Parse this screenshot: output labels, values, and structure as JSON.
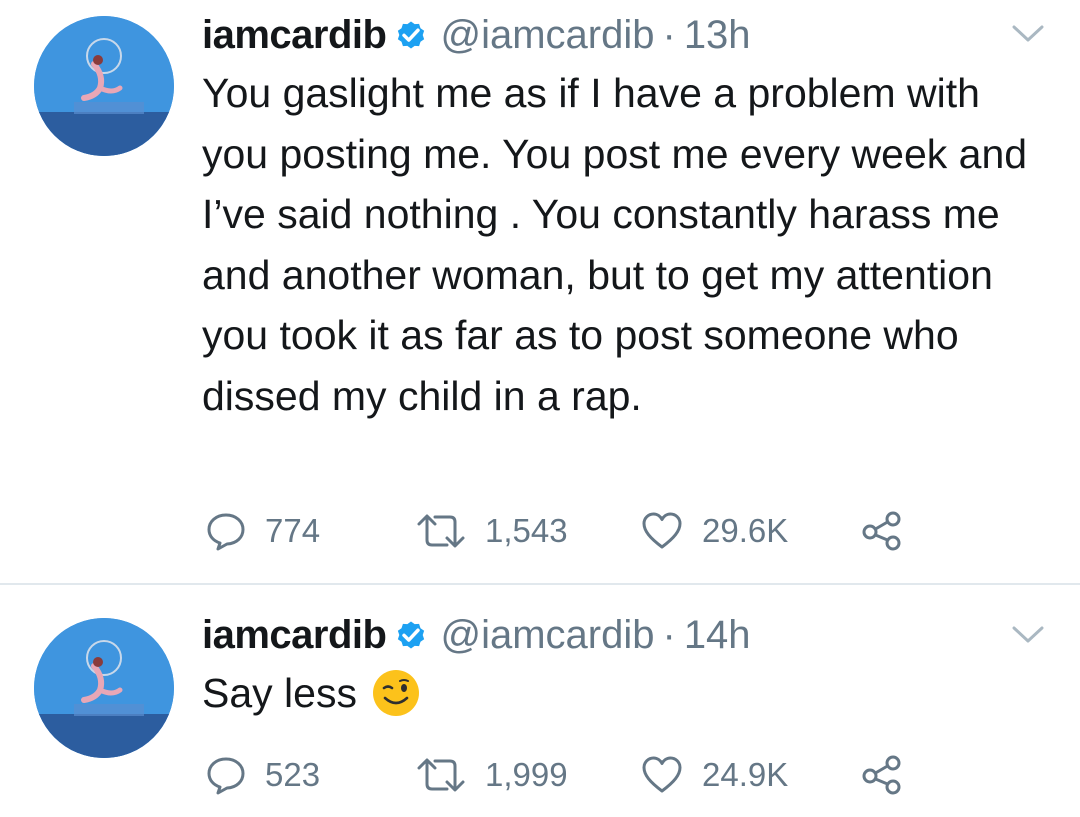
{
  "tweets": [
    {
      "display_name": "iamcardib",
      "handle": "@iamcardib",
      "separator": "·",
      "time": "13h",
      "text": "You gaslight me as if I have a problem with you posting me. You post me every week and I’ve said nothing . You constantly harass me and another woman, but to get my attention you took it as far as to post someone who dissed my child in a rap.",
      "emoji": "",
      "replies": "774",
      "retweets": "1,543",
      "likes": "29.6K"
    },
    {
      "display_name": "iamcardib",
      "handle": "@iamcardib",
      "separator": "·",
      "time": "14h",
      "text": "Say less",
      "emoji": "winking-face-emoji",
      "replies": "523",
      "retweets": "1,999",
      "likes": "24.9K"
    }
  ],
  "colors": {
    "text": "#14171a",
    "secondary": "#657786",
    "verified": "#1da1f2",
    "divider": "#e1e8ed"
  },
  "icons": {
    "verified": "verified-badge-icon",
    "caret": "chevron-down-icon",
    "reply": "reply-icon",
    "retweet": "retweet-icon",
    "like": "heart-icon",
    "share": "share-icon"
  }
}
